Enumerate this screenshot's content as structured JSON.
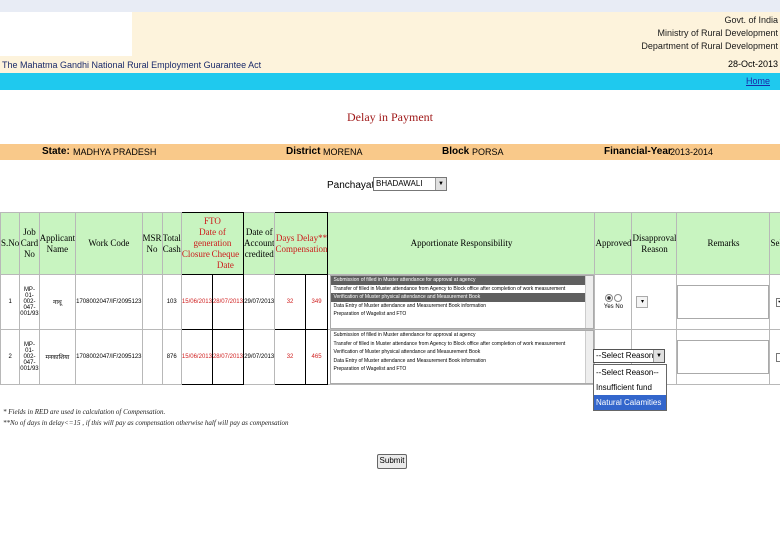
{
  "header": {
    "gov_line1": "Govt. of India",
    "gov_line2": "Ministry of Rural Development",
    "gov_line3": "Department of Rural Development",
    "act_title": "The Mahatma Gandhi National Rural Employment Guarantee Act",
    "date": "28-Oct-2013",
    "home_link": "Home"
  },
  "page_title": "Delay in Payment",
  "info": {
    "state_label": "State:",
    "state": "MADHYA PRADESH",
    "district_label": "District",
    "district": "MORENA",
    "block_label": "Block",
    "block": "PORSA",
    "fy_label": "Financial-Year",
    "fy": "2013-2014"
  },
  "panchayat": {
    "label": "Panchayat",
    "value": "BHADAWALI"
  },
  "table": {
    "headers": {
      "sno": "S.No",
      "job_card_no": "Job Card No",
      "applicant": "Applicant Name",
      "work_code": "Work Code",
      "msr_no": "MSR No",
      "total_cash": "Total Cash",
      "fto": "FTO",
      "date_generation": "Date of generation",
      "closure": "Closure",
      "cheque_date": "Cheque Date",
      "date_account": "Date of Account credited",
      "days_delay": "Days Delay**",
      "compensation": "Compensation",
      "apportionate": "Apportionate Responsibility",
      "approved": "Approved",
      "disapproval": "Disapproval Reason",
      "remarks": "Remarks",
      "select": "Selec"
    },
    "responsibility_options": [
      "Submission of filled in Muster attendance for approval at agency",
      "Transfer of filled in Muster attendance from Agency to Block office after completion of work measurement",
      "Verification of Muster physical attendance and Measurement Book",
      "Data Entry of Muster attendance and Measurement Book information",
      "Preparation of Wagelist and FTO"
    ],
    "rows": [
      {
        "sno": "1",
        "job_card": "MP-01-002-047-001/93",
        "applicant": "नाथू",
        "work_code": "1708002047/IF/2095123",
        "msr": "103",
        "closure": "15/06/2013",
        "cheque": "28/07/2013",
        "credited": "29/07/2013",
        "days_delay": "32",
        "compensation": "349",
        "selected_resp": [
          0,
          2
        ],
        "approved": "yes",
        "select_checked": true
      },
      {
        "sno": "2",
        "job_card": "MP-01-002-047-001/93",
        "applicant": "मनकाशिया",
        "work_code": "1708002047/IF/2095123",
        "msr": "876",
        "closure": "15/06/2013",
        "cheque": "28/07/2013",
        "credited": "29/07/2013",
        "days_delay": "32",
        "compensation": "465",
        "selected_resp": [],
        "approved": "none",
        "select_checked": false
      }
    ],
    "yes_label": "Yes",
    "no_label": "No"
  },
  "reason_dropdown": {
    "selected": "--Select Reason--",
    "options": [
      "--Select Reason--",
      "Insufficient fund",
      "Natural Calamities"
    ],
    "highlighted": "Natural Calamities"
  },
  "notes": {
    "line1": "* Fields in RED are used in calculation of Compensation.",
    "line2": "**No of days in delay<=15 , if this will pay as compensation otherwise half will pay as compensation"
  },
  "submit_label": "Submit",
  "colors": {
    "cyan_bar": "#1fc9ee",
    "info_bar": "#f9c98a",
    "header_green": "#c8f4c0",
    "title_red": "#a01a1a"
  }
}
